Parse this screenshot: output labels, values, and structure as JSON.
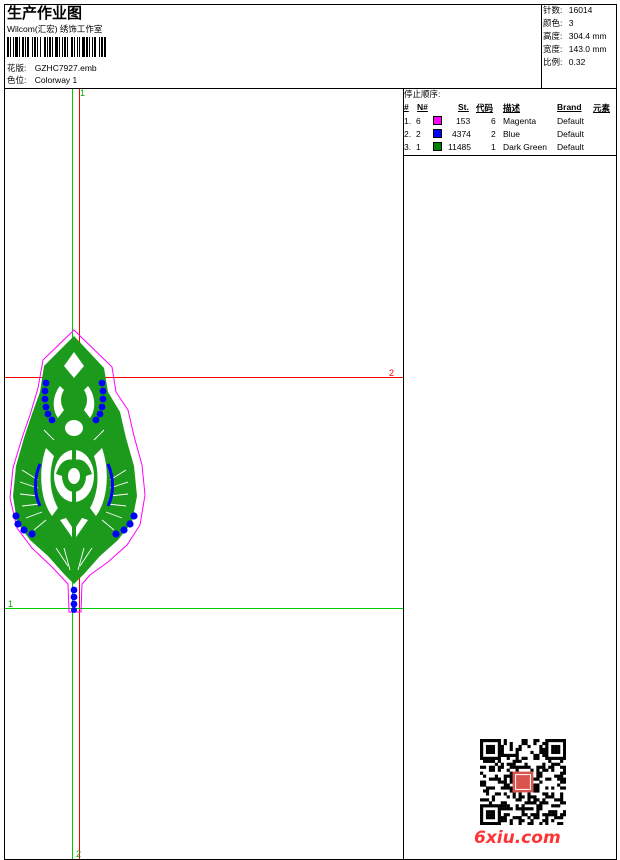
{
  "header": {
    "title": "生产作业图",
    "subtitle": "Wilcom(汇宏) 绣饰工作室",
    "file_label": "花版:",
    "file_value": "GZHC7927.emb",
    "colorway_label": "色位:",
    "colorway_value": "Colorway 1"
  },
  "stats": [
    {
      "label": "针数:",
      "value": "16014"
    },
    {
      "label": "颜色:",
      "value": "3"
    },
    {
      "label": "高度:",
      "value": "304.4 mm"
    },
    {
      "label": "宽度:",
      "value": "143.0 mm"
    },
    {
      "label": "比例:",
      "value": "0.32"
    }
  ],
  "stop_sequence": {
    "title": "停止顺序:",
    "columns": [
      "#",
      "N#",
      "St.",
      "代码",
      "描述",
      "Brand",
      "元素"
    ],
    "rows": [
      {
        "index": "1.",
        "n": "6",
        "color": "#ff00ff",
        "stitches": "153",
        "code": "6",
        "desc": "Magenta",
        "brand": "Default"
      },
      {
        "index": "2.",
        "n": "2",
        "color": "#0000ff",
        "stitches": "4374",
        "code": "2",
        "desc": "Blue",
        "brand": "Default"
      },
      {
        "index": "3.",
        "n": "1",
        "color": "#008000",
        "stitches": "11485",
        "code": "1",
        "desc": "Dark Green",
        "brand": "Default"
      }
    ]
  },
  "guides": {
    "green_v_top": "1",
    "green_v_bottom": "2",
    "red_h_label": "2",
    "green_h_label": "1"
  },
  "colors": {
    "outline": "#ff00ff",
    "fill": "#008000",
    "beads": "#0000ff",
    "guide_red": "#ff0000",
    "guide_green": "#00cc00",
    "watermark": "#ff3333"
  },
  "watermark": "6xiu.com"
}
